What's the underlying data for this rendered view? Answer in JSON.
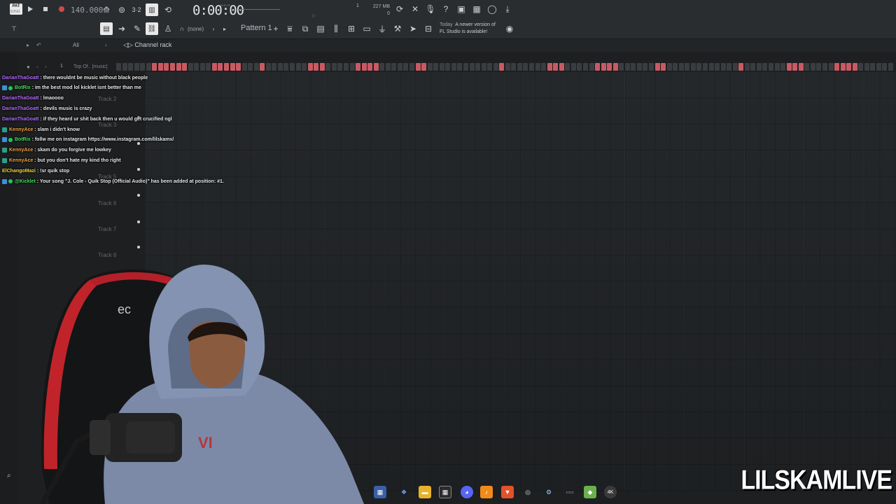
{
  "toolbar": {
    "pat_badge": "PAT",
    "pat_sub": "SONG",
    "bpm": "140.000",
    "time": "0:00:00",
    "time_sub": "M:S:CS",
    "step_counter": "1",
    "memory": "227 MB",
    "memory_sub": "0",
    "pattern_label": "Pattern 1",
    "none_label": "(none)",
    "update_today": "Today",
    "update_text_1": "A newer version of",
    "update_text_2": "FL Studio is available!"
  },
  "channel_rack": {
    "filter": "All",
    "title": "Channel rack",
    "channel_number": "1",
    "channel_name": "Top Of.. [music]",
    "steps_on_color": "#c85a63"
  },
  "playlist": {
    "tracks": [
      "Track 2",
      "Track 3",
      "Track 5",
      "Track 6",
      "Track 7",
      "Track 8"
    ]
  },
  "chat": [
    {
      "user": "DarianThaGoatt",
      "color": "#b46bff",
      "badge": "",
      "message": ": there wouldnt be music without black people"
    },
    {
      "user": "BotRix",
      "color": "#3de15b",
      "badge": "bot",
      "message": ": im the best mod lol kicklet isnt better than me"
    },
    {
      "user": "DarianThaGoatt",
      "color": "#b46bff",
      "badge": "",
      "message": ": lmaoooo"
    },
    {
      "user": "DarianThaGoatt",
      "color": "#b46bff",
      "badge": "",
      "message": ": devils music is crazy"
    },
    {
      "user": "DarianThaGoatt",
      "color": "#b46bff",
      "badge": "",
      "message": ": if they heard ur shit back then u would get crucified ngl"
    },
    {
      "user": "KennyAce",
      "color": "#f5a23a",
      "badge": "sub",
      "message": ": slam i didn't know"
    },
    {
      "user": "BotRix",
      "color": "#3de15b",
      "badge": "bot",
      "message": ": follw me on instagram https://www.instagram.com/lilskamx/"
    },
    {
      "user": "KennyAce",
      "color": "#f5a23a",
      "badge": "sub",
      "message": ": skam do you forgive me lowkey"
    },
    {
      "user": "KennyAce",
      "color": "#f5a23a",
      "badge": "sub",
      "message": ": but you don't hate my kind tho right"
    },
    {
      "user": "ElChangoMazi",
      "color": "#f5d43a",
      "badge": "",
      "message": ": !sr quik stop"
    },
    {
      "user": "@Kicklet",
      "color": "#3de15b",
      "badge": "bot",
      "message": ": Your song \"J. Cole - Quik Stop (Official Audio)\" has been added at position: #1."
    }
  ],
  "taskbar": {
    "icons": [
      "flag-icon",
      "copilot-icon",
      "folder-icon",
      "store-icon",
      "discord-icon",
      "fl-studio-icon",
      "brave-icon",
      "chrome-icon",
      "steam-icon",
      "app-icon",
      "app2-icon",
      "4k-icon"
    ],
    "label_4k": "4K"
  },
  "watermark": "LILSKAMLIVE"
}
